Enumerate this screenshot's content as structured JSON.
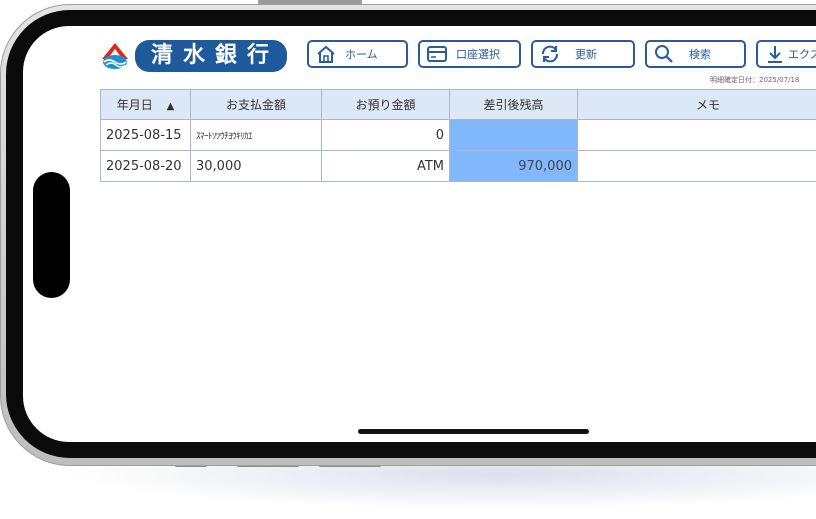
{
  "app": {
    "bank_name": "清水銀行"
  },
  "toolbar": {
    "home_label": "ホーム",
    "account_select_label": "口座選択",
    "refresh_label": "更新",
    "search_label": "検索",
    "export_label": "エクスポ"
  },
  "statement": {
    "confirm_date": "明細確定日付：2025/07/18",
    "sort_indicator": "▲",
    "columns": {
      "date": "年月日",
      "payment": "お支払金額",
      "deposit": "お預り金額",
      "balance": "差引後残高",
      "memo": "メモ"
    },
    "rows": [
      {
        "date": "2025-08-15",
        "payment": "ｽﾏｰﾄｿﾂｳﾁﾖｳｷﾘｶｴ",
        "deposit": "0",
        "balance": "",
        "memo": ""
      },
      {
        "date": "2025-08-20",
        "payment": "30,000",
        "deposit": "ATM",
        "balance": "970,000",
        "memo": ""
      }
    ]
  },
  "colors": {
    "brand": "#1f5a9c",
    "header_bg": "#dde8f6",
    "balance_highlight": "#80b8fb"
  },
  "icons": [
    "bank-logo-icon",
    "home-icon",
    "card-icon",
    "refresh-icon",
    "search-icon",
    "download-icon"
  ]
}
